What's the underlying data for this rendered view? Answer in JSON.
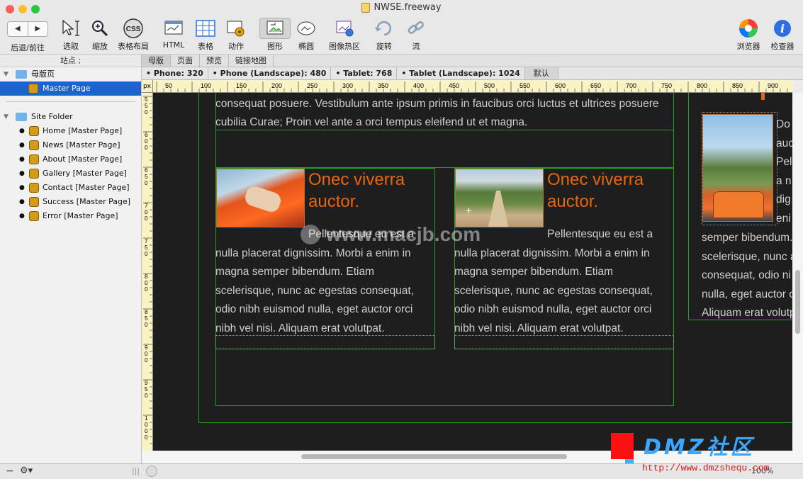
{
  "window": {
    "title": "NWSE.freeway",
    "light_colors": [
      "#fe5f57",
      "#febc2e",
      "#28c840"
    ]
  },
  "toolbar": {
    "back_forward": "后退/前往",
    "back_glyph": "◀",
    "forward_glyph": "▶",
    "select": "选取",
    "zoom": "缩放",
    "css_icon": "CSS",
    "css_layout": "表格布局",
    "html": "HTML",
    "table": "表格",
    "action": "动作",
    "graphic": "图形",
    "ellipse": "椭圆",
    "image_hotspot": "图像热区",
    "rotate": "旋转",
    "flow": "流",
    "browser": "浏览器",
    "inspector": "检查器",
    "inspector_glyph": "i"
  },
  "sidebar": {
    "header": "站点 ;",
    "master_group": "母版页",
    "master_page": "Master Page",
    "site_folder": "Site Folder",
    "pages": [
      "Home [Master Page]",
      "News [Master Page]",
      "About [Master Page]",
      "Gallery [Master Page]",
      "Contact [Master Page]",
      "Success [Master Page]",
      "Error [Master Page]"
    ]
  },
  "tabs": [
    "母版",
    "页面",
    "预览",
    "链接地图"
  ],
  "breakpoints": [
    "• Phone: 320",
    "• Phone (Landscape): 480",
    "• Tablet: 768",
    "• Tablet (Landscape): 1024",
    "默认"
  ],
  "ruler": {
    "unit": "px",
    "marks": [
      "50",
      "100",
      "150",
      "200",
      "250",
      "300",
      "350",
      "400",
      "450",
      "500",
      "550",
      "600",
      "650",
      "700",
      "750",
      "800",
      "850",
      "900"
    ],
    "vmarks": [
      "550",
      "600",
      "650",
      "700",
      "750",
      "800",
      "850",
      "900",
      "950",
      "1000"
    ]
  },
  "content": {
    "intro_line1": "consequat posuere. Vestibulum ante ipsum primis in faucibus orci luctus et ultrices posuere",
    "intro_line2": "cubilia Curae; Proin vel ante a orci tempus eleifend ut et magna.",
    "card_heading": "Onec viverra auctor.",
    "card_lines": [
      "Pellentesque eu est a",
      "nulla placerat dignissim. Morbi a enim in",
      "magna semper bibendum. Etiam",
      "scelerisque, nunc ac egestas consequat,",
      "odio nibh euismod nulla, eget auctor orci",
      "nibh vel nisi. Aliquam erat volutpat."
    ],
    "right_top_lines": [
      "Do",
      "auc",
      "Pel",
      "a n",
      "dig",
      "eni"
    ],
    "right_lines": [
      "semper bibendum.",
      "scelerisque, nunc a",
      "consequat, odio ni",
      "nulla, eget auctor o",
      "Aliquam erat volutp"
    ]
  },
  "watermark": {
    "center": "www.macjb.com",
    "brand": "DMZ社区",
    "url": "http://www.dmzshequ.com"
  },
  "status": {
    "minus": "−",
    "gear": "⚙▾",
    "zoom": "100%"
  }
}
